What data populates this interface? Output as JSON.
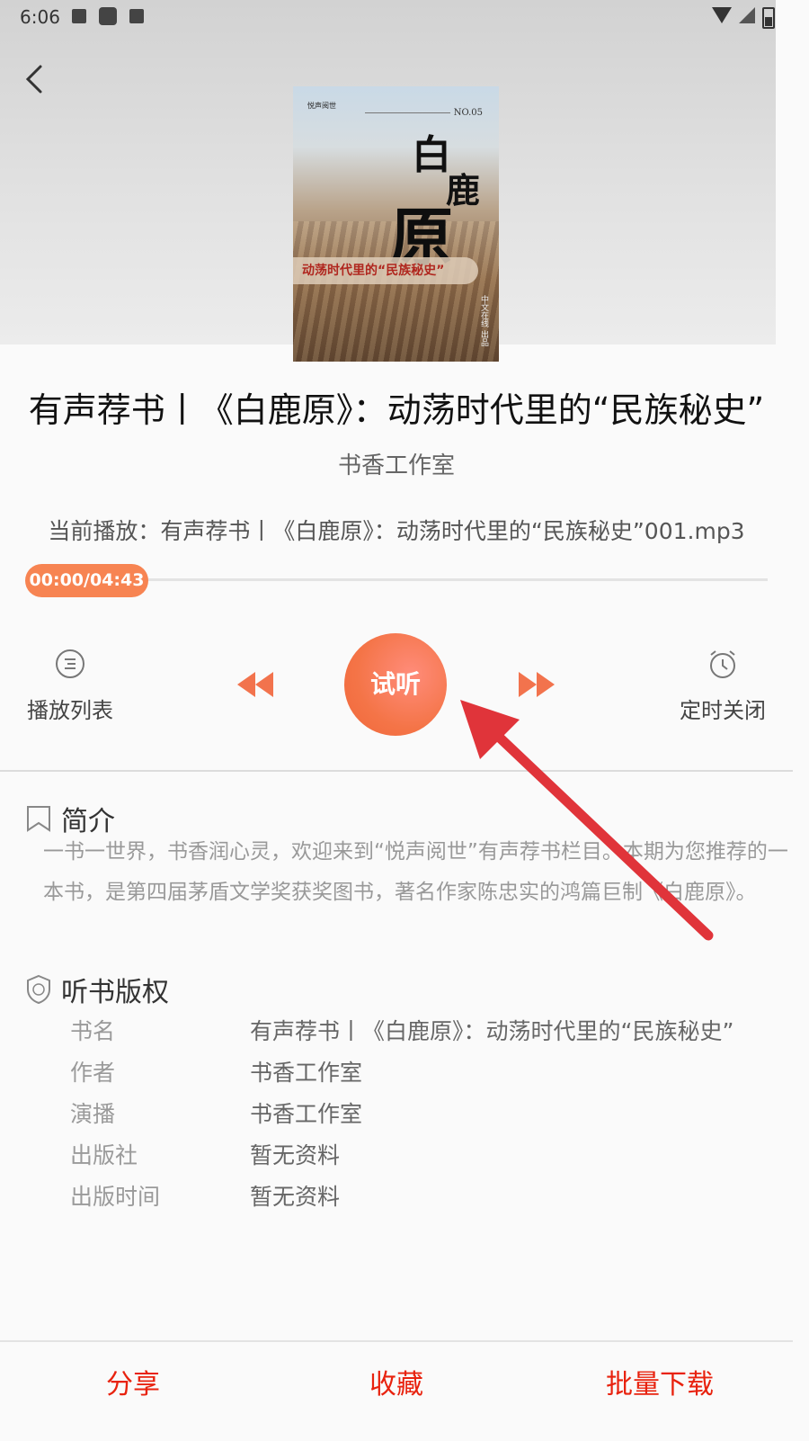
{
  "status_bar": {
    "time": "6:06"
  },
  "book": {
    "title": "有声荐书丨《白鹿原》：动荡时代里的“民族秘史”",
    "author": "书香工作室",
    "now_playing": "当前播放：有声荐书丨《白鹿原》：动荡时代里的“民族秘史”001.mp3"
  },
  "cover": {
    "brand": "悦声阅世",
    "number": "NO.05",
    "title_chars": [
      "白",
      "鹿",
      "原"
    ],
    "subtitle": "动荡时代里的“民族秘史”",
    "publisher": "中文在线 出品"
  },
  "player": {
    "time_display": "00:00/04:43",
    "progress": 0,
    "play_label": "试听",
    "playlist_label": "播放列表",
    "timer_label": "定时关闭"
  },
  "intro": {
    "heading": "简介",
    "text": "一书一世界，书香润心灵，欢迎来到“悦声阅世”有声荐书栏目。本期为您推荐的一本书，是第四届茅盾文学奖获奖图书，著名作家陈忠实的鸿篇巨制《白鹿原》。"
  },
  "rights": {
    "heading": "听书版权",
    "rows": [
      {
        "key": "书名",
        "value": "有声荐书丨《白鹿原》：动荡时代里的“民族秘史”"
      },
      {
        "key": "作者",
        "value": "书香工作室"
      },
      {
        "key": "演播",
        "value": "书香工作室"
      },
      {
        "key": "出版社",
        "value": "暂无资料"
      },
      {
        "key": "出版时间",
        "value": "暂无资料"
      }
    ]
  },
  "bottom_bar": {
    "share": "分享",
    "favorite": "收藏",
    "batch_download": "批量下载"
  },
  "colors": {
    "accent": "#f47447",
    "bottom_text": "#e8220e",
    "arrow": "#e0343a"
  }
}
